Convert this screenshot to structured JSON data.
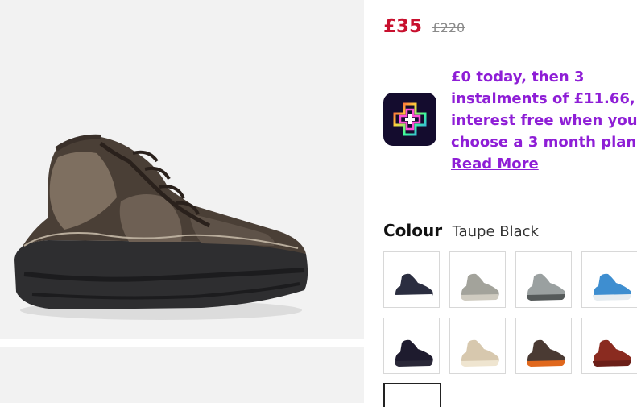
{
  "product": {
    "price_now": "£35",
    "price_was": "£220"
  },
  "bnpl": {
    "logo_icon": "bnpl-cross-logo-icon",
    "lines": [
      "£0 today, then 3",
      "instalments of £11.66,",
      "interest free when you",
      "choose a 3 month plan."
    ],
    "read_more": "Read More"
  },
  "colour": {
    "label": "Colour",
    "selected": "Taupe Black"
  },
  "swatches": [
    {
      "name": "navy-black",
      "color": "#2b2e40",
      "sole": "#ffffff"
    },
    {
      "name": "light-grey",
      "color": "#a3a39b",
      "sole": "#cfcbc0"
    },
    {
      "name": "grey-dark-sole",
      "color": "#9aa0a0",
      "sole": "#555a5a"
    },
    {
      "name": "light-blue",
      "color": "#3e8ed0",
      "sole": "#e6ecf0"
    },
    {
      "name": "black-purple",
      "color": "#1e1b2e",
      "sole": "#2a2838"
    },
    {
      "name": "blush",
      "color": "#d7c8ae",
      "sole": "#efe5d0"
    },
    {
      "name": "brown-orange-sole",
      "color": "#4a3a33",
      "sole": "#e0681d"
    },
    {
      "name": "rust-red",
      "color": "#8a2b20",
      "sole": "#6b1f18"
    }
  ],
  "colors": {
    "price_red": "#c8102e",
    "bnpl_purple": "#8e1ed6"
  }
}
